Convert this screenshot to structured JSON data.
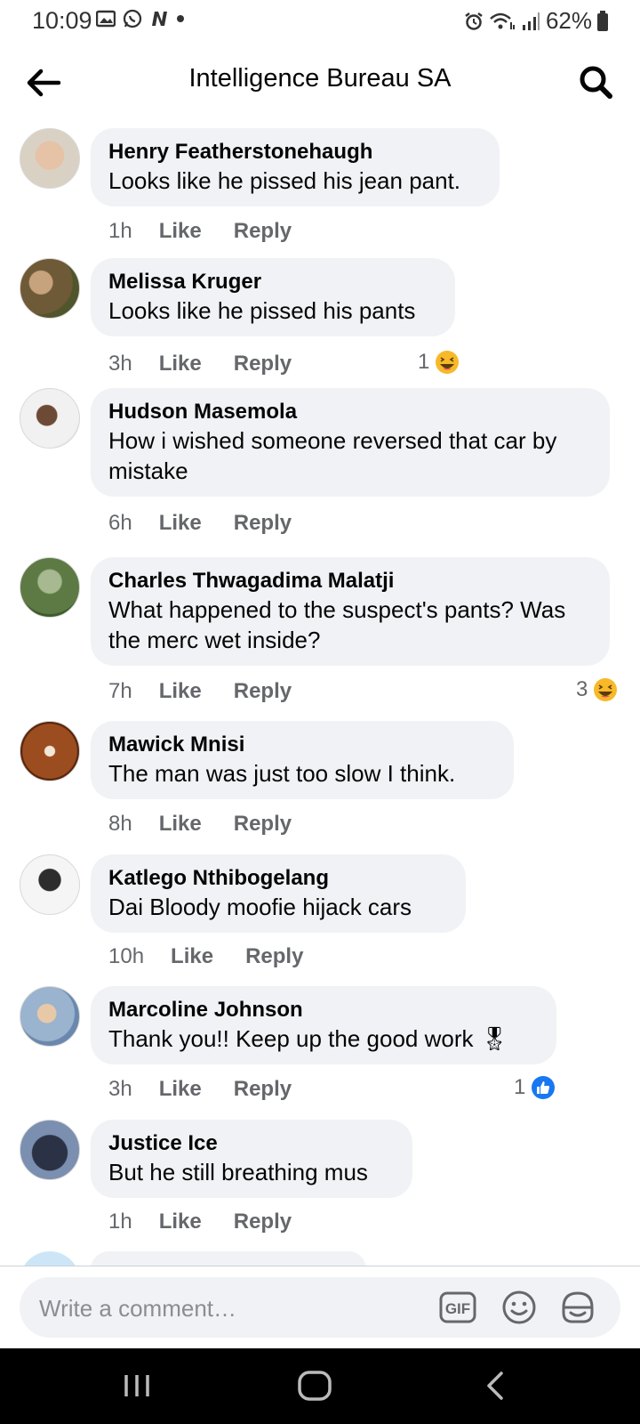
{
  "status_bar": {
    "time": "10:09",
    "battery": "62%",
    "left_icons": [
      "gallery-icon",
      "whatsapp-icon",
      "n-app-icon",
      "dot-icon"
    ],
    "right_icons": [
      "alarm-icon",
      "wifi-icon",
      "signal-icon",
      "battery-icon"
    ]
  },
  "header": {
    "title": "Intelligence Bureau SA"
  },
  "actions": {
    "like": "Like",
    "reply": "Reply"
  },
  "comments": [
    {
      "author": "Henry Featherstonehaugh",
      "text": "Looks like he pissed his jean pant.",
      "time": "1h"
    },
    {
      "author": "Melissa Kruger",
      "text": "Looks like he pissed his pants",
      "time": "3h",
      "reaction": {
        "count": "1",
        "type": "haha"
      }
    },
    {
      "author": "Hudson Masemola",
      "text": "How i wished someone reversed that car by mistake",
      "time": "6h"
    },
    {
      "author": "Charles Thwagadima Malatji",
      "text": "What happened to the suspect's pants? Was the merc wet inside?",
      "time": "7h",
      "reaction": {
        "count": "3",
        "type": "haha"
      }
    },
    {
      "author": "Mawick Mnisi",
      "text": "The man was just too slow I think.",
      "time": "8h"
    },
    {
      "author": "Katlego Nthibogelang",
      "text": "Dai Bloody moofie hijack cars",
      "time": "10h"
    },
    {
      "author": "Marcoline Johnson",
      "text": "Thank you!! Keep up the good work 🎖",
      "time": "3h",
      "reaction": {
        "count": "1",
        "type": "like"
      }
    },
    {
      "author": "Justice Ice",
      "text": "But he still breathing mus",
      "time": "1h"
    }
  ],
  "composer": {
    "placeholder": "Write a comment…",
    "gif_label": "GIF"
  },
  "colors": {
    "bubble": "#f0f2f5",
    "secondary_text": "#65676b",
    "like_blue": "#1877f2",
    "haha_yellow": "#f7b928"
  }
}
